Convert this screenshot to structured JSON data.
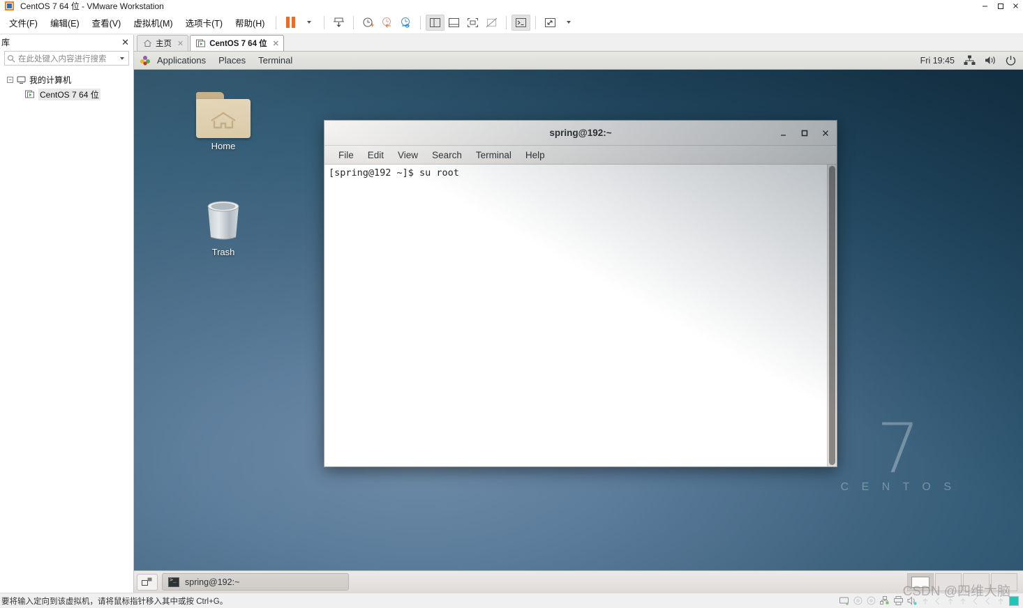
{
  "window": {
    "title": "CentOS 7 64 位 - VMware Workstation",
    "minimize": "minimize-button",
    "maximize": "maximize-button",
    "close": "close-button"
  },
  "menubar": {
    "items": [
      {
        "label": "文件(F)",
        "name": "menu-file"
      },
      {
        "label": "编辑(E)",
        "name": "menu-edit"
      },
      {
        "label": "查看(V)",
        "name": "menu-view"
      },
      {
        "label": "虚拟机(M)",
        "name": "menu-vm"
      },
      {
        "label": "选项卡(T)",
        "name": "menu-tabs"
      },
      {
        "label": "帮助(H)",
        "name": "menu-help"
      }
    ]
  },
  "toolbar": {
    "buttons": [
      {
        "name": "suspend-pause-icon",
        "tip": "暂停"
      },
      {
        "name": "power-dropdown-caret",
        "tip": "电源"
      },
      {
        "name": "snapshot-take-icon",
        "tip": "拍摄快照"
      },
      {
        "name": "snapshot-manage-icon",
        "tip": "快照管理"
      },
      {
        "name": "snapshot-revert-icon",
        "tip": "恢复快照"
      },
      {
        "name": "snapshot-settings-icon",
        "tip": "快照设置"
      },
      {
        "name": "show-library-icon",
        "tip": "显示库"
      },
      {
        "name": "show-thumbnail-bar-icon",
        "tip": "缩略图栏"
      },
      {
        "name": "fullscreen-icon",
        "tip": "全屏"
      },
      {
        "name": "unity-mode-icon",
        "tip": "Unity 模式"
      },
      {
        "name": "console-view-icon",
        "tip": "控制台视图"
      },
      {
        "name": "stretch-guest-icon",
        "tip": "拉伸"
      },
      {
        "name": "stretch-dropdown-caret",
        "tip": "拉伸选项"
      }
    ]
  },
  "sidebar": {
    "title": "库",
    "close_label": "✕",
    "search_placeholder": "在此处键入内容进行搜索",
    "search_value": "",
    "tree": [
      {
        "label": "我的计算机",
        "name": "tree-item-my-computer",
        "expanded": true
      },
      {
        "label": "CentOS 7 64 位",
        "name": "tree-item-centos7",
        "selected": true
      }
    ]
  },
  "tabs": [
    {
      "label": "主页",
      "name": "tab-home",
      "active": false,
      "close": "✕"
    },
    {
      "label": "CentOS 7 64 位",
      "name": "tab-centos7",
      "active": true,
      "close": "✕"
    }
  ],
  "guest": {
    "panel": {
      "applications": "Applications",
      "places": "Places",
      "terminal": "Terminal",
      "clock": "Fri 19:45",
      "network_icon": "network-icon",
      "volume_icon": "volume-icon",
      "power_icon": "power-icon"
    },
    "desktop": {
      "icons": [
        {
          "label": "Home",
          "name": "desktop-icon-home"
        },
        {
          "label": "Trash",
          "name": "desktop-icon-trash"
        }
      ],
      "watermark_number": "7",
      "watermark_word": "C E N T O S"
    },
    "terminal": {
      "title": "spring@192:~",
      "menus": [
        "File",
        "Edit",
        "View",
        "Search",
        "Terminal",
        "Help"
      ],
      "content": "[spring@192 ~]$ su root",
      "minimize": "_",
      "maximize": "□",
      "close": "✕"
    },
    "taskbar": {
      "show_desktop": "show-desktop-button",
      "window_label": "spring@192:~",
      "workspaces": 4,
      "active_workspace": 1
    }
  },
  "statusbar": {
    "text": "要将输入定向到该虚拟机，请将鼠标指针移入其中或按 Ctrl+G。",
    "icons": [
      "harddisk-icon",
      "cdrom-icon",
      "cdrom2-icon",
      "network-adapter-icon",
      "printer-icon",
      "sound-icon",
      "usb-icon",
      "usb2-icon",
      "usb3-icon",
      "usb4-icon",
      "usb5-icon",
      "usb6-icon",
      "usb7-icon"
    ]
  },
  "watermark": {
    "text": "CSDN @四维大脑"
  }
}
